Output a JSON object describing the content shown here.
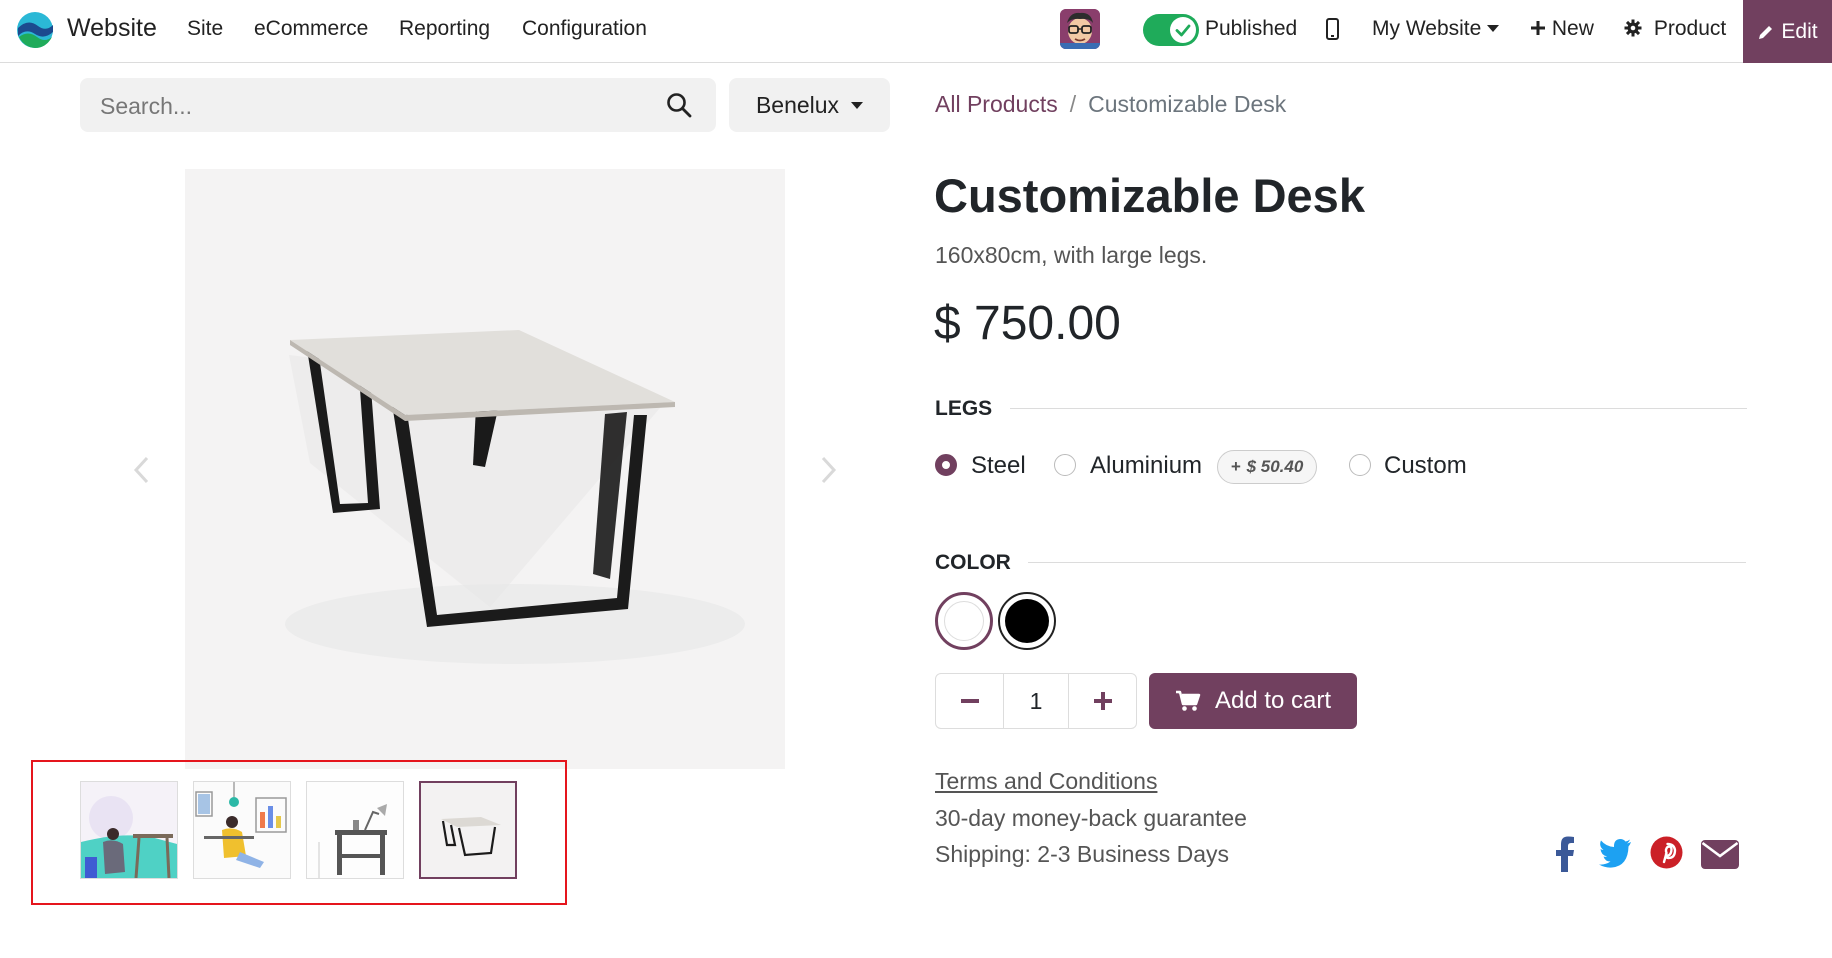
{
  "navbar": {
    "app_name": "Website",
    "menu": [
      "Site",
      "eCommerce",
      "Reporting",
      "Configuration"
    ],
    "published_label": "Published",
    "website_label": "My Website",
    "new_label": "New",
    "product_label": "Product",
    "edit_label": "Edit"
  },
  "search": {
    "placeholder": "Search...",
    "pricelist_label": "Benelux"
  },
  "breadcrumb": {
    "parent": "All Products",
    "current": "Customizable Desk"
  },
  "product": {
    "name": "Customizable Desk",
    "description": "160x80cm, with large legs.",
    "price": "$ 750.00"
  },
  "attributes": {
    "legs": {
      "label": "LEGS",
      "options": [
        "Steel",
        "Aluminium",
        "Custom"
      ],
      "selected": "Steel",
      "extra_sign": "+",
      "aluminium_extra": "$ 50.40"
    },
    "color": {
      "label": "COLOR",
      "options": [
        "white",
        "black"
      ],
      "selected": "white"
    }
  },
  "quantity": {
    "value": "1"
  },
  "cart": {
    "add_label": "Add to cart"
  },
  "info": {
    "terms": "Terms and Conditions",
    "guarantee": "30-day money-back guarantee",
    "shipping": "Shipping: 2-3 Business Days"
  },
  "colors": {
    "accent": "#71405f",
    "published_green": "#1fab5a",
    "highlight_red": "#e5151d",
    "facebook": "#3b5998",
    "twitter": "#1da1f2",
    "pinterest": "#cb2027",
    "email": "#71405f"
  },
  "icons": [
    "logo-icon",
    "avatar",
    "check-icon",
    "phone-icon",
    "plus-icon",
    "gear-icon",
    "pencil-icon",
    "search-icon",
    "chevron-left-icon",
    "chevron-right-icon",
    "minus-icon",
    "cart-icon",
    "facebook-icon",
    "twitter-icon",
    "pinterest-icon",
    "email-icon"
  ]
}
